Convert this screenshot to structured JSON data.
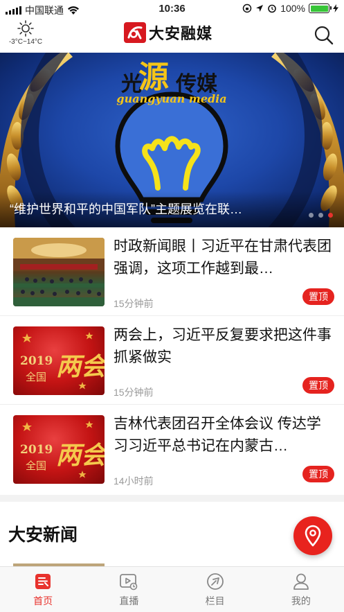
{
  "status_bar": {
    "carrier": "中国联通",
    "time": "10:36",
    "battery": "100%",
    "battery_level": 1.0
  },
  "header": {
    "weather_temp": "-3°C~14°C",
    "weather_icon": "sun-icon",
    "logo_text": "大安融媒",
    "search_icon": "search-icon"
  },
  "banner": {
    "art_text_top": "光源传媒",
    "art_text_bottom": "guangyuan media",
    "caption": "“维护世界和平的中国军队”主题展览在联…",
    "slide_count": 3,
    "active_slide": 3
  },
  "news": [
    {
      "title": "时政新闻眼丨习近平在甘肃代表团强调，这项工作越到最…",
      "time": "15分钟前",
      "badge": "置顶"
    },
    {
      "title": "两会上，习近平反复要求把这件事抓紧做实",
      "time": "15分钟前",
      "badge": "置顶",
      "thumb_year": "2019",
      "thumb_word": "全国",
      "thumb_big": "两会"
    },
    {
      "title": "吉林代表团召开全体会议 传达学习习近平总书记在内蒙古…",
      "time": "14小时前",
      "badge": "置顶",
      "thumb_year": "2019",
      "thumb_word": "全国",
      "thumb_big": "两会"
    }
  ],
  "section": {
    "title": "大安新闻"
  },
  "fab": {
    "icon": "location-pin-icon"
  },
  "tabs": [
    {
      "label": "首页",
      "icon": "home-news-icon",
      "active": true
    },
    {
      "label": "直播",
      "icon": "live-video-icon",
      "active": false
    },
    {
      "label": "栏目",
      "icon": "columns-icon",
      "active": false
    },
    {
      "label": "我的",
      "icon": "profile-icon",
      "active": false
    }
  ],
  "colors": {
    "accent": "#e8322d",
    "badge": "#e5231f",
    "battery": "#37c538"
  }
}
